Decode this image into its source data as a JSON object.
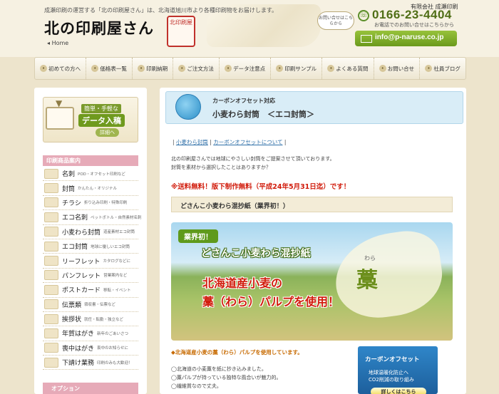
{
  "header": {
    "tagline": "成瀬印刷の運営する「北の印刷屋さん」は、北海道旭川市より各種印刷物をお届けします。",
    "logo_text": "北の印刷屋さん",
    "logo_seal": "北印刷屋",
    "home_link": "Home",
    "company_name": "有限会社 成瀬印刷",
    "contact_bubble": "お問い合せはこちらから",
    "phone_number": "0166-23-4404",
    "phone_sub": "お電話でのお問い合せはこちらから",
    "email": "info@p-naruse.co.jp"
  },
  "nav": {
    "items": [
      {
        "label": "初めての方へ"
      },
      {
        "label": "価格表一覧"
      },
      {
        "label": "印刷納期"
      },
      {
        "label": "ご注文方法"
      },
      {
        "label": "データ注意点"
      },
      {
        "label": "印刷サンプル"
      },
      {
        "label": "よくある質問"
      },
      {
        "label": "お問い合せ"
      },
      {
        "label": "社員ブログ"
      }
    ]
  },
  "sidebar": {
    "banner": {
      "line1": "簡単・手軽な",
      "line2": "データ入稿",
      "detail": "詳細へ"
    },
    "products_heading": "印刷商品案内",
    "products": [
      {
        "name": "名刺",
        "desc": "POD・オフセット印刷など"
      },
      {
        "name": "封筒",
        "desc": "かんたん・オリジナル"
      },
      {
        "name": "チラシ",
        "desc": "折り込み印刷・特殊印刷"
      },
      {
        "name": "エコ名刺",
        "desc": "ペットボトル・自然素材名刺"
      },
      {
        "name": "小麦わら封筒",
        "desc": "道産素材エコ封筒"
      },
      {
        "name": "エコ封筒",
        "desc": "地球に優しいエコ封筒"
      },
      {
        "name": "リーフレット",
        "desc": "カタログなどに"
      },
      {
        "name": "パンフレット",
        "desc": "営業案内など"
      },
      {
        "name": "ポストカード",
        "desc": "移転・イベント"
      },
      {
        "name": "伝票類",
        "desc": "領収書・伝票など"
      },
      {
        "name": "挨拶状",
        "desc": "就任・転勤・独立など"
      },
      {
        "name": "年賀はがき",
        "desc": "新年のごあいさつ"
      },
      {
        "name": "喪中はがき",
        "desc": "喪中のお知らせに"
      },
      {
        "name": "下請け業務",
        "desc": "印刷のみも大歓迎！"
      }
    ],
    "option_heading": "オプション"
  },
  "main": {
    "title_sub": "カーボンオフセット対応",
    "title_main": "小麦わら封筒　＜エコ封筒＞",
    "breadcrumb": {
      "sep": "|",
      "link1": "小麦わら封筒",
      "link2": "カーボンオフセットについて"
    },
    "intro1": "北の印刷屋さんでは地球にやさしい封筒をご提案させて頂いております。",
    "intro2": "封筒を素材から選択したことはありますか？",
    "promo": "※送料無料！版下制作無料（平成24年5月31日迄）です！",
    "product_band": "どさんこ小麦わら混抄紙（業界初！）",
    "hero": {
      "badge": "業界初！",
      "line1": "どさんこ小麦わら混抄紙",
      "line2": "北海道産小麦の",
      "line3": "藁（わら）パルプを使用！",
      "ruby": "わら",
      "kanji": "藁"
    },
    "feature_head": "◆北海道産小麦の藁（わら）パルプを使用しています。",
    "features": [
      "◯北海道の小麦藁を紙に抄き込みました。",
      "◯藁パルプが持っている独特な風合いが魅力的。",
      "◯繊維質なので丈夫。"
    ],
    "carbon": {
      "title": "カーボンオフセット",
      "sub1": "地球温暖化防止へ",
      "sub2": "CO2削減の取り組み",
      "button": "詳しくはこちら"
    }
  },
  "colors": {
    "accent_green": "#6b9a1c",
    "promo_red": "#d11c0c",
    "sidebar_pink": "#e6aab8",
    "carbon_blue": "#2f86c9"
  }
}
